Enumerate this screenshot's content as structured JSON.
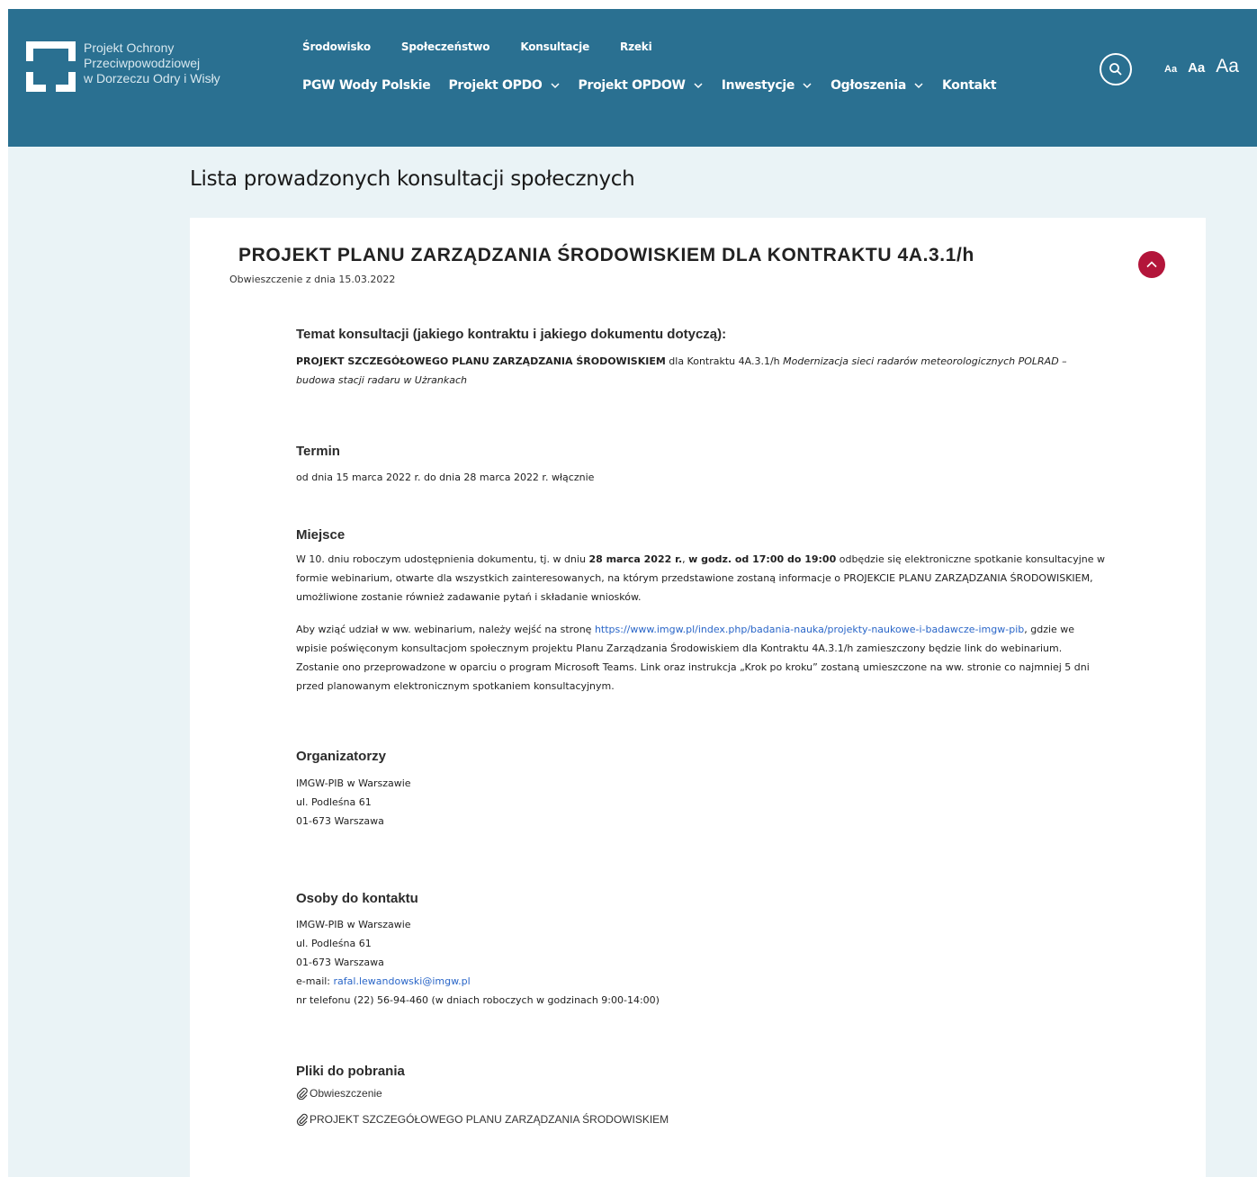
{
  "brand": {
    "name_lines": [
      "Projekt Ochrony",
      "Przeciwpowodziowej",
      "w Dorzeczu Odry i Wisły"
    ],
    "colors": {
      "header_bg": "#2a7091",
      "page_bg": "#eaf3f6",
      "accent_red": "#b3153a",
      "link": "#2a66c8"
    }
  },
  "nav": {
    "top": [
      "Środowisko",
      "Społeczeństwo",
      "Konsultacje",
      "Rzeki"
    ],
    "main": [
      {
        "label": "PGW Wody Polskie",
        "dropdown": false
      },
      {
        "label": "Projekt OPDO",
        "dropdown": true
      },
      {
        "label": "Projekt OPDOW",
        "dropdown": true
      },
      {
        "label": "Inwestycje",
        "dropdown": true
      },
      {
        "label": "Ogłoszenia",
        "dropdown": true
      },
      {
        "label": "Kontakt",
        "dropdown": false
      }
    ],
    "search_icon": "search-icon",
    "font_sizes": [
      "Aa",
      "Aa",
      "Aa"
    ]
  },
  "page": {
    "title": "Lista prowadzonych konsultacji społecznych"
  },
  "card": {
    "title": "PROJEKT PLANU ZARZĄDZANIA ŚRODOWISKIEM DLA KONTRAKTU 4A.3.1/h",
    "date": "Obwieszczenie z dnia 15.03.2022",
    "toggle_icon": "chevron-up-icon",
    "sections": {
      "temat": {
        "heading": "Temat konsultacji (jakiego kontraktu i jakiego dokumentu dotyczą):",
        "bold": "PROJEKT SZCZEGÓŁOWEGO PLANU ZARZĄDZANIA ŚRODOWISKIEM",
        "plain": " dla Kontraktu 4A.3.1/h ",
        "italic": "Modernizacja sieci radarów meteorologicznych POLRAD – budowa stacji radaru w Użrankach"
      },
      "termin": {
        "heading": "Termin",
        "text": "od dnia 15 marca 2022 r. do dnia 28 marca 2022 r. włącznie"
      },
      "miejsce": {
        "heading": "Miejsce",
        "p1_a": "W 10. dniu roboczym udostępnienia dokumentu, tj. w dniu ",
        "p1_b1": "28 marca 2022 r.",
        "p1_c": ", ",
        "p1_b2": "w godz. od 17:00 do 19:00",
        "p1_d": " odbędzie się elektroniczne spotkanie konsultacyjne w formie webinarium, otwarte dla wszystkich zainteresowanych, na którym przedstawione zostaną informacje o PROJEKCIE PLANU ZARZĄDZANIA ŚRODOWISKIEM, umożliwione zostanie również zadawanie pytań i składanie wniosków.",
        "p2_a": "Aby wziąć udział w ww. webinarium, należy wejść na stronę ",
        "p2_link": "https://www.imgw.pl/index.php/badania-nauka/projekty-naukowe-i-badawcze-imgw-pib",
        "p2_b": ", gdzie we wpisie poświęconym konsultacjom społecznym projektu Planu Zarządzania Środowiskiem dla Kontraktu 4A.3.1/h zamieszczony będzie link do webinarium. Zostanie ono przeprowadzone w oparciu o program Microsoft Teams. Link oraz instrukcja „Krok po kroku” zostaną umieszczone na ww. stronie co najmniej 5 dni przed planowanym elektronicznym spotkaniem konsultacyjnym."
      },
      "organizatorzy": {
        "heading": "Organizatorzy",
        "lines": [
          "IMGW-PIB w Warszawie",
          "ul. Podleśna 61",
          "01-673 Warszawa"
        ]
      },
      "kontakt": {
        "heading": "Osoby do kontaktu",
        "lines": [
          "IMGW-PIB w Warszawie",
          "ul. Podleśna 61",
          "01-673 Warszawa"
        ],
        "email_label": "e-mail: ",
        "email": "rafal.lewandowski@imgw.pl",
        "phone": "nr telefonu (22) 56-94-460 (w dniach roboczych w godzinach 9:00-14:00)"
      },
      "pliki": {
        "heading": "Pliki do pobrania",
        "files": [
          "Obwieszczenie",
          "PROJEKT SZCZEGÓŁOWEGO PLANU ZARZĄDZANIA ŚRODOWISKIEM"
        ],
        "file_icon": "paperclip-icon"
      }
    }
  }
}
